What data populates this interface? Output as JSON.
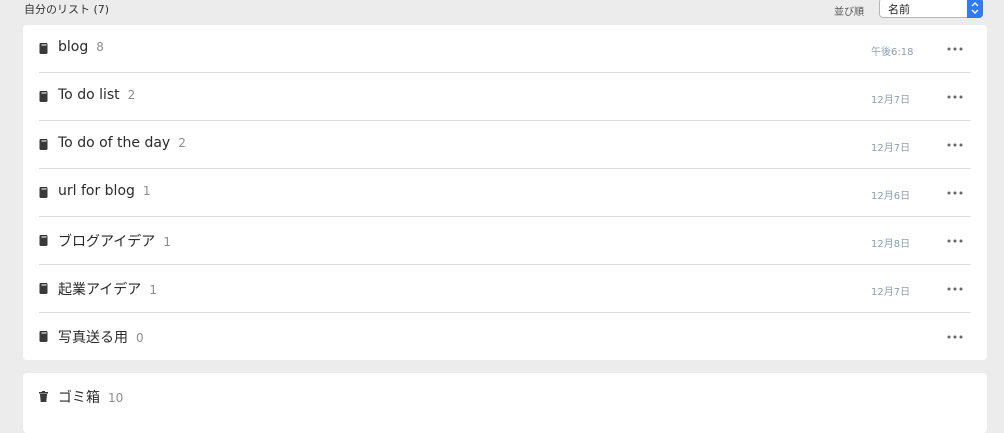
{
  "header": {
    "title": "自分のリスト (7)",
    "sort_label": "並び順",
    "sort_value": "名前"
  },
  "notebooks": [
    {
      "name": "blog",
      "count": "8",
      "date": "午後6:18"
    },
    {
      "name": "To do list",
      "count": "2",
      "date": "12月7日"
    },
    {
      "name": "To do of the day",
      "count": "2",
      "date": "12月7日"
    },
    {
      "name": "url for blog",
      "count": "1",
      "date": "12月6日"
    },
    {
      "name": "ブログアイデア",
      "count": "1",
      "date": "12月8日"
    },
    {
      "name": "起業アイデア",
      "count": "1",
      "date": "12月7日"
    },
    {
      "name": "写真送る用",
      "count": "0",
      "date": ""
    }
  ],
  "trash": {
    "name": "ゴミ箱",
    "count": "10"
  },
  "colors": {
    "accent": "#2f7bf5",
    "background": "#ececec",
    "date_text": "#8ca0b0"
  },
  "icons": {
    "notebook": "notebook-icon",
    "more": "more-options-icon",
    "trash": "trash-icon",
    "sort_dropdown": "chevron-updown-icon"
  }
}
